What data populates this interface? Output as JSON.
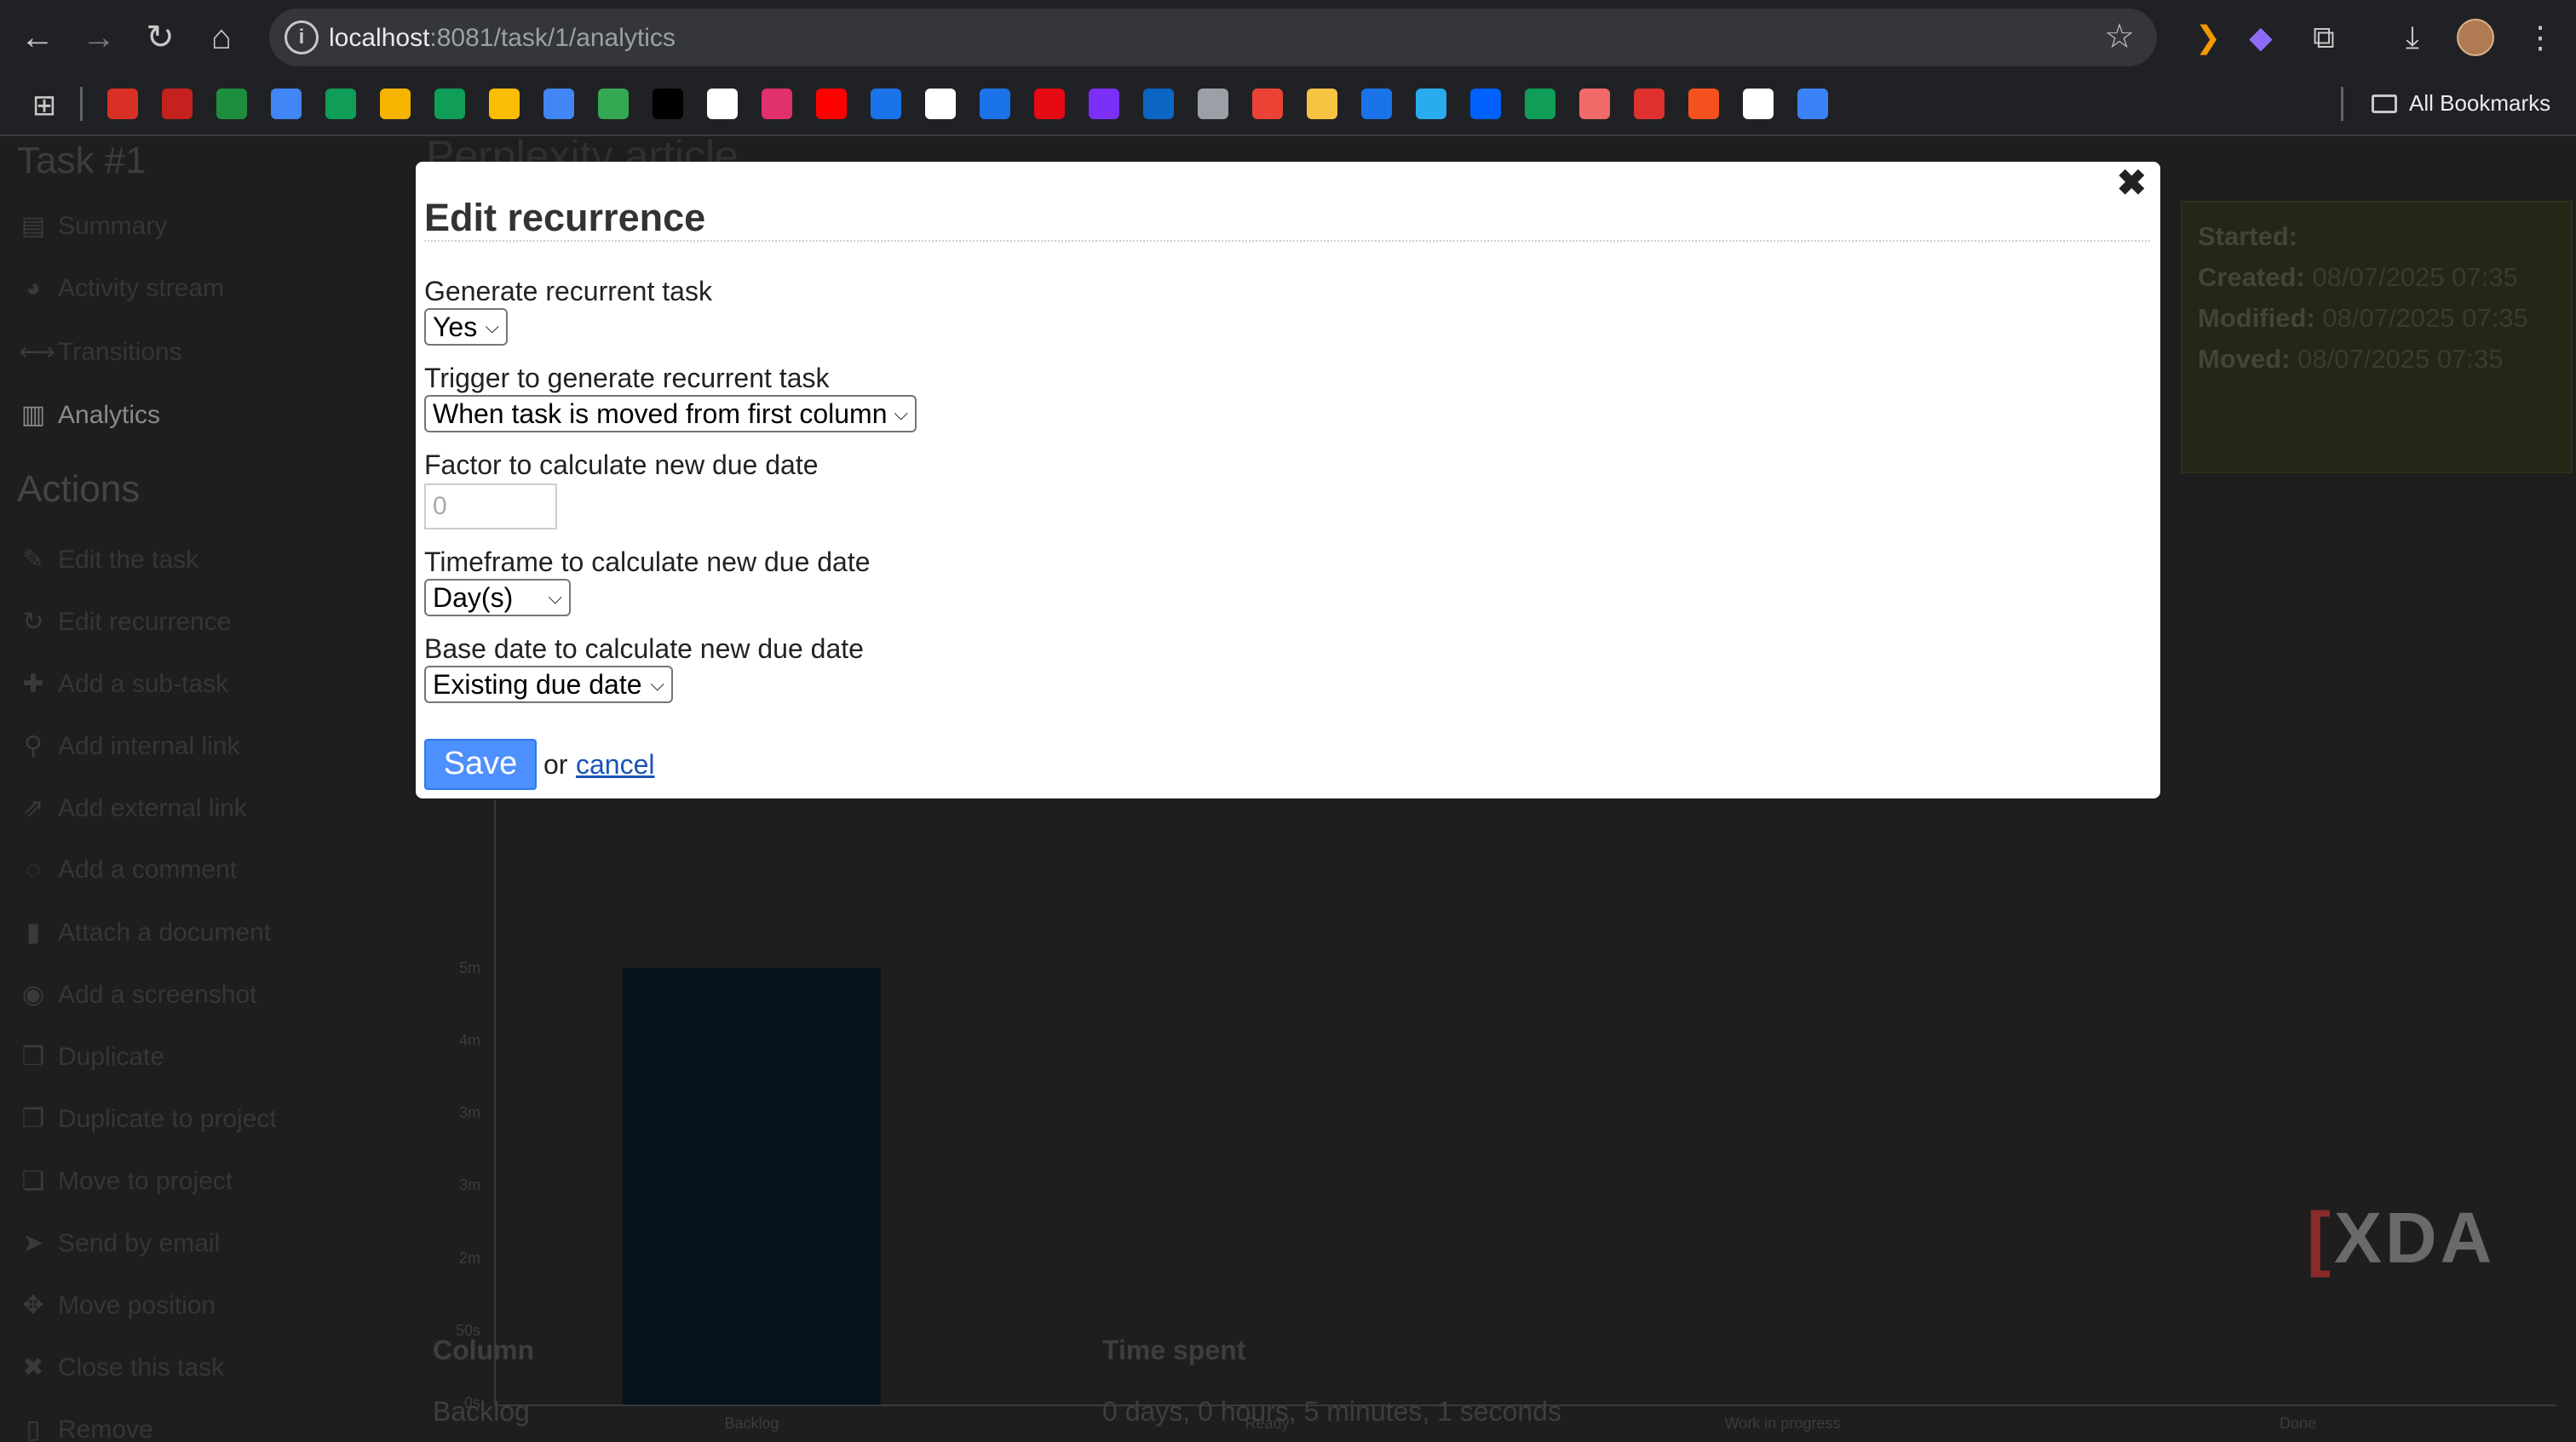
{
  "browser": {
    "url_host": "localhost",
    "url_path": ":8081/task/1/analytics",
    "all_bookmarks_label": "All Bookmarks",
    "bookmark_icons": [
      {
        "name": "bookmark-1",
        "color": "#d93025"
      },
      {
        "name": "bookmark-2",
        "color": "#c5221f"
      },
      {
        "name": "bookmark-3",
        "color": "#1e8e3e"
      },
      {
        "name": "bookmark-4",
        "color": "#4285f4"
      },
      {
        "name": "bookmark-5",
        "color": "#0f9d58"
      },
      {
        "name": "bookmark-6",
        "color": "#f4b400"
      },
      {
        "name": "bookmark-7",
        "color": "#0f9d58"
      },
      {
        "name": "bookmark-8",
        "color": "#fbbc04"
      },
      {
        "name": "bookmark-9",
        "color": "#4285f4"
      },
      {
        "name": "bookmark-10",
        "color": "#34a853"
      },
      {
        "name": "bookmark-11",
        "color": "#000000"
      },
      {
        "name": "bookmark-12",
        "color": "#ffffff"
      },
      {
        "name": "bookmark-13",
        "color": "#e1306c"
      },
      {
        "name": "bookmark-14",
        "color": "#ff0000"
      },
      {
        "name": "bookmark-15",
        "color": "#1a73e8"
      },
      {
        "name": "bookmark-16",
        "color": "#ffffff"
      },
      {
        "name": "bookmark-17",
        "color": "#1a73e8"
      },
      {
        "name": "bookmark-18",
        "color": "#e50914"
      },
      {
        "name": "bookmark-19",
        "color": "#7b2ff7"
      },
      {
        "name": "bookmark-20",
        "color": "#0a66c2"
      },
      {
        "name": "bookmark-21",
        "color": "#9aa0a6"
      },
      {
        "name": "bookmark-22",
        "color": "#ea4335"
      },
      {
        "name": "bookmark-23",
        "color": "#f6c343"
      },
      {
        "name": "bookmark-24",
        "color": "#1a73e8"
      },
      {
        "name": "bookmark-25",
        "color": "#2aabee"
      },
      {
        "name": "bookmark-26",
        "color": "#0061ff"
      },
      {
        "name": "bookmark-27",
        "color": "#0f9d58"
      },
      {
        "name": "bookmark-28",
        "color": "#f06a6a"
      },
      {
        "name": "bookmark-29",
        "color": "#e03131"
      },
      {
        "name": "bookmark-30",
        "color": "#f4511e"
      },
      {
        "name": "bookmark-31",
        "color": "#ffffff"
      },
      {
        "name": "bookmark-32",
        "color": "#3b82f6"
      }
    ]
  },
  "page": {
    "task_title": "Task #1",
    "bg_task_name": "Perplexity article",
    "sidebar_items": [
      {
        "label": "Summary",
        "glyph": "▤"
      },
      {
        "label": "Activity stream",
        "glyph": "◕"
      },
      {
        "label": "Transitions",
        "glyph": "⟷"
      },
      {
        "label": "Analytics",
        "glyph": "▥"
      }
    ],
    "actions_title": "Actions",
    "action_items": [
      {
        "label": "Edit the task",
        "glyph": "✎"
      },
      {
        "label": "Edit recurrence",
        "glyph": "↻"
      },
      {
        "label": "Add a sub-task",
        "glyph": "✚"
      },
      {
        "label": "Add internal link",
        "glyph": "⚲"
      },
      {
        "label": "Add external link",
        "glyph": "⇗"
      },
      {
        "label": "Add a comment",
        "glyph": "◌"
      },
      {
        "label": "Attach a document",
        "glyph": "▮"
      },
      {
        "label": "Add a screenshot",
        "glyph": "◉"
      },
      {
        "label": "Duplicate",
        "glyph": "❐"
      },
      {
        "label": "Duplicate to project",
        "glyph": "❐"
      },
      {
        "label": "Move to project",
        "glyph": "❏"
      },
      {
        "label": "Send by email",
        "glyph": "➤"
      },
      {
        "label": "Move position",
        "glyph": "✥"
      },
      {
        "label": "Close this task",
        "glyph": "✖"
      },
      {
        "label": "Remove",
        "glyph": "▯"
      }
    ],
    "meta": {
      "started_label": "Started:",
      "created_label": "Created:",
      "created_value": "08/07/2025 07:35",
      "modified_label": "Modified:",
      "modified_value": "08/07/2025 07:35",
      "moved_label": "Moved:",
      "moved_value": "08/07/2025 07:35"
    },
    "time_table": {
      "col_header": "Column",
      "time_header": "Time spent",
      "rows": [
        {
          "column": "Backlog",
          "time": "0 days, 0 hours, 5 minutes, 1 seconds"
        }
      ]
    }
  },
  "chart_data": {
    "type": "bar",
    "categories": [
      "Backlog",
      "Ready",
      "Work in progress",
      "Done"
    ],
    "values": [
      301,
      0,
      0,
      0
    ],
    "ytick_labels": [
      "5m",
      "4m",
      "3m",
      "3m",
      "2m",
      "50s",
      "0s"
    ],
    "ytick_values": [
      300,
      250,
      200,
      150,
      100,
      50,
      0
    ],
    "ylim": [
      0,
      300
    ]
  },
  "modal": {
    "title": "Edit recurrence",
    "close_glyph": "✖",
    "fields": {
      "generate_label": "Generate recurrent task",
      "generate_value": "Yes",
      "trigger_label": "Trigger to generate recurrent task",
      "trigger_value": "When task is moved from first column",
      "factor_label": "Factor to calculate new due date",
      "factor_placeholder": "0",
      "timeframe_label": "Timeframe to calculate new due date",
      "timeframe_value": "Day(s)",
      "basedate_label": "Base date to calculate new due date",
      "basedate_value": "Existing due date"
    },
    "save_label": "Save",
    "or_text": "or",
    "cancel_label": "cancel"
  },
  "watermark": {
    "text": "XDA"
  }
}
